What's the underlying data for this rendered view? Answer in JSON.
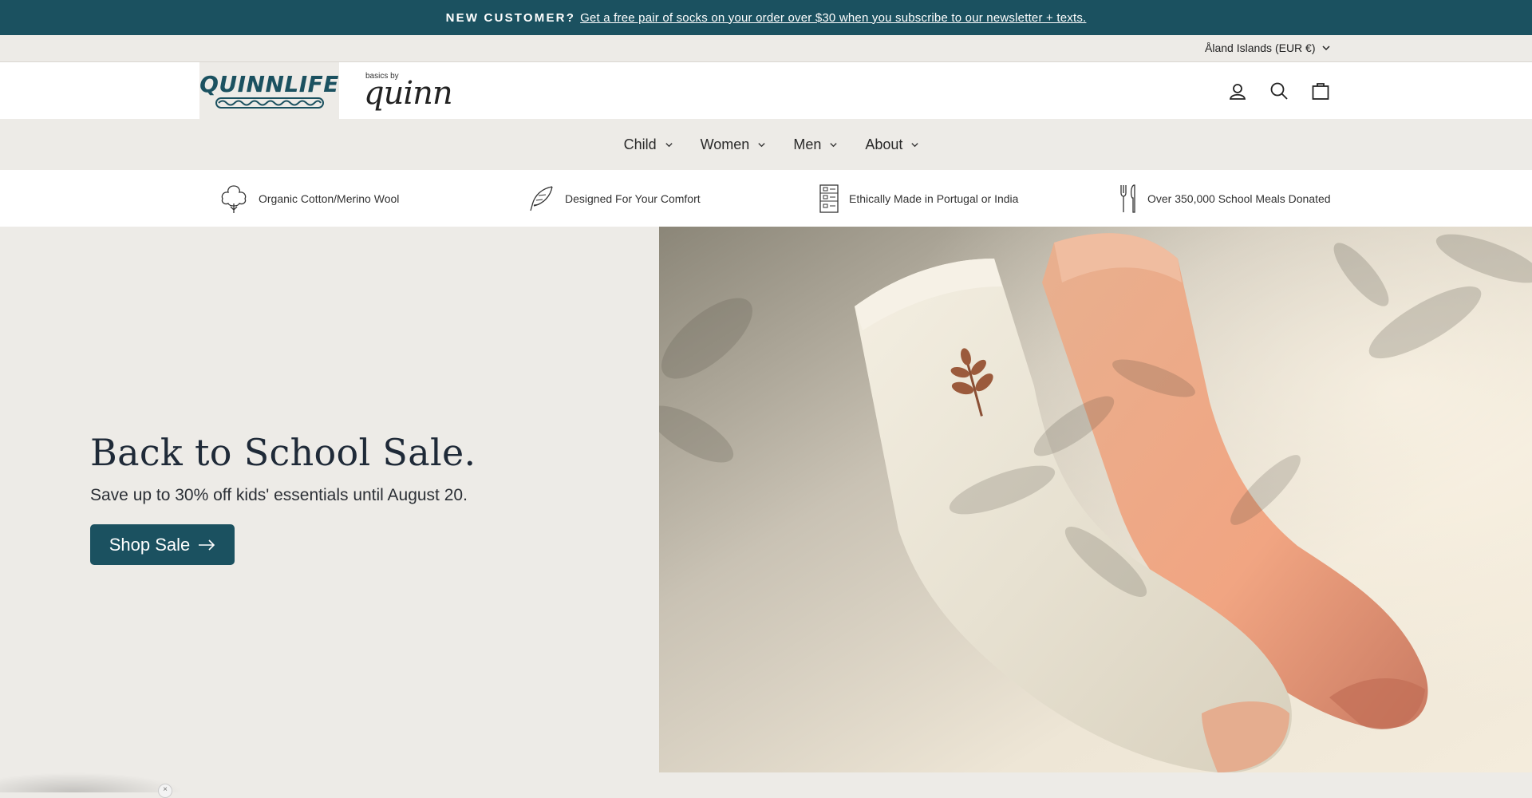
{
  "announcement": {
    "lead": "NEW CUSTOMER?",
    "link_text": "Get a free pair of socks on your order over $30 when you subscribe to our newsletter + texts."
  },
  "utility": {
    "region_label": "Åland Islands (EUR €)"
  },
  "header": {
    "logo_quinnlife": "QUINNLIFE",
    "logo_basics_small": "basics by",
    "logo_basics_script": "quinn",
    "icons": [
      "account-icon",
      "search-icon",
      "cart-icon"
    ]
  },
  "nav": {
    "items": [
      {
        "label": "Child"
      },
      {
        "label": "Women"
      },
      {
        "label": "Men"
      },
      {
        "label": "About"
      }
    ]
  },
  "features": [
    {
      "label": "Organic Cotton/Merino Wool",
      "icon": "cotton-icon"
    },
    {
      "label": "Designed For Your Comfort",
      "icon": "feather-icon"
    },
    {
      "label": "Ethically Made in Portugal or India",
      "icon": "factory-icon"
    },
    {
      "label": "Over 350,000 School Meals Donated",
      "icon": "utensils-icon"
    }
  ],
  "hero": {
    "title": "Back to School Sale.",
    "subtitle": "Save up to 30% off kids' essentials until August 20.",
    "button_label": "Shop Sale",
    "image": "socks-photo"
  },
  "popup": {
    "close_label": "×"
  },
  "colors": {
    "brand": "#1b5160",
    "background": "#edebe7"
  }
}
